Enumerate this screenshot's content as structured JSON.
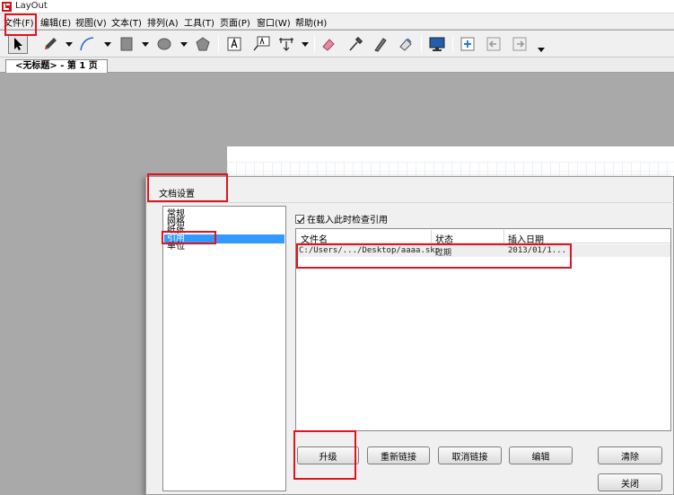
{
  "window": {
    "title": "LayOut"
  },
  "menu": [
    {
      "label": "文件(F)"
    },
    {
      "label": "编辑(E)"
    },
    {
      "label": "视图(V)"
    },
    {
      "label": "文本(T)"
    },
    {
      "label": "排列(A)"
    },
    {
      "label": "工具(T)"
    },
    {
      "label": "页面(P)"
    },
    {
      "label": "窗口(W)"
    },
    {
      "label": "帮助(H)"
    }
  ],
  "toolbar": {
    "icons": [
      "select-arrow-icon",
      "pencil-icon",
      "arc-icon",
      "rectangle-icon",
      "ellipse-icon",
      "polygon-icon",
      "text-icon",
      "label-icon",
      "dimension-icon",
      "eraser-icon",
      "eyedropper-icon",
      "split-icon",
      "join-icon",
      "presentation-icon",
      "add-page-icon",
      "previous-page-icon",
      "next-page-icon"
    ]
  },
  "tab": {
    "label": "<无标题> - 第 1 页"
  },
  "dialog": {
    "title": "文档设置",
    "nav": [
      "常规",
      "网格",
      "纸张",
      "引用",
      "单位"
    ],
    "selected_nav": "引用",
    "check_label": "在载入此时检查引用",
    "table": {
      "headers": [
        "文件名",
        "状态",
        "插入日期"
      ],
      "rows": [
        {
          "file": "C:/Users/.../Desktop/aaaa.skp",
          "status": "过期",
          "date": "2013/01/1..."
        }
      ]
    },
    "buttons": {
      "upgrade": "升级",
      "relink": "重新链接",
      "unlink": "取消链接",
      "edit": "编辑",
      "purge": "清除",
      "close": "关闭"
    }
  },
  "colors": {
    "highlight": "#e0141e",
    "selection": "#3399ff"
  }
}
